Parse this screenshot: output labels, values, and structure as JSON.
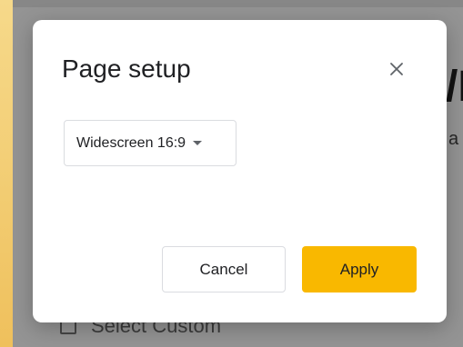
{
  "background": {
    "heading_fragment": "/I",
    "subtext_fragment": "a",
    "bottom_option": "Select  Custom"
  },
  "dialog": {
    "title": "Page setup",
    "close_icon": "close-icon",
    "page_size": {
      "selected": "Widescreen 16:9",
      "caret_icon": "caret-down-icon"
    },
    "cancel_label": "Cancel",
    "apply_label": "Apply"
  },
  "colors": {
    "apply_button": "#f9b800",
    "overlay": "rgba(0,0,0,0.42)",
    "left_stripe": "#f3cf77"
  }
}
